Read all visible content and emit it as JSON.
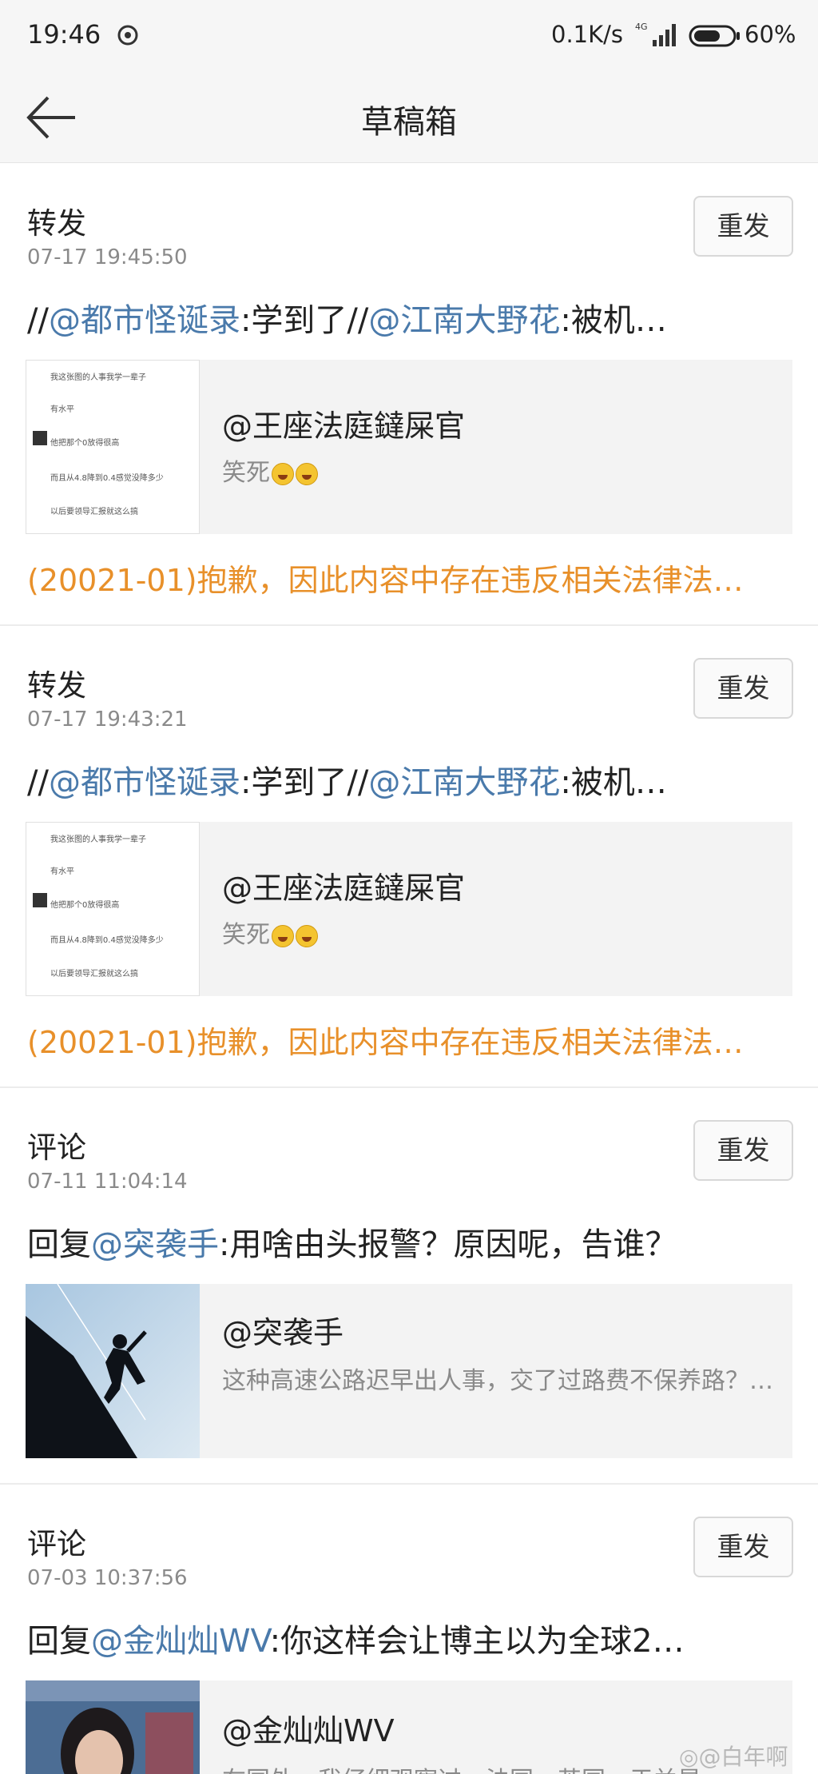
{
  "status_bar": {
    "time": "19:46",
    "network_speed": "0.1K/s",
    "network_type": "4G",
    "battery": "60%"
  },
  "nav": {
    "title": "草稿箱",
    "back_icon": "back-arrow-icon"
  },
  "drafts": [
    {
      "type": "转发",
      "time": "07-17 19:45:50",
      "resend_label": "重发",
      "text": {
        "prefix": "//",
        "mention1": "@都市怪诞录",
        "mid": ":学到了//",
        "mention2": "@江南大野花",
        "suffix": ":被机…"
      },
      "quote": {
        "author": "@王座法庭鐽屎官",
        "body": "笑死",
        "thumb_lines": [
          "我这张图的人事我学一辈子",
          "有水平",
          "他把那个0放得很高",
          "而且从4.8降到0.4感觉没降多少",
          "以后要领导汇报就这么搞"
        ]
      },
      "error": "(20021-01)抱歉，因此内容中存在违反相关法律法…"
    },
    {
      "type": "转发",
      "time": "07-17 19:43:21",
      "resend_label": "重发",
      "text": {
        "prefix": "//",
        "mention1": "@都市怪诞录",
        "mid": ":学到了//",
        "mention2": "@江南大野花",
        "suffix": ":被机…"
      },
      "quote": {
        "author": "@王座法庭鐽屎官",
        "body": "笑死",
        "thumb_lines": [
          "我这张图的人事我学一辈子",
          "有水平",
          "他把那个0放得很高",
          "而且从4.8降到0.4感觉没降多少",
          "以后要领导汇报就这么搞"
        ]
      },
      "error": "(20021-01)抱歉，因此内容中存在违反相关法律法…"
    },
    {
      "type": "评论",
      "time": "07-11 11:04:14",
      "resend_label": "重发",
      "text": {
        "prefix": "回复",
        "mention1": "@突袭手",
        "suffix": ":用啥由头报警？原因呢，告谁？"
      },
      "quote": {
        "author": "@突袭手",
        "body": "这种高速公路迟早出人事，交了过路费不保养路？…"
      }
    },
    {
      "type": "评论",
      "time": "07-03 10:37:56",
      "resend_label": "重发",
      "text": {
        "prefix": "回复",
        "mention1": "@金灿灿WV",
        "suffix": ":你这样会让博主以为全球2…"
      },
      "quote": {
        "author": "@金灿灿WV",
        "body": "在国外，我仔细观察过，法国，英国，于兰是"
      }
    }
  ],
  "watermark": "@白年啊",
  "colors": {
    "mention": "#4a7aab",
    "error": "#e8902a",
    "background": "#ffffff",
    "nav_background": "#f6f6f6"
  }
}
